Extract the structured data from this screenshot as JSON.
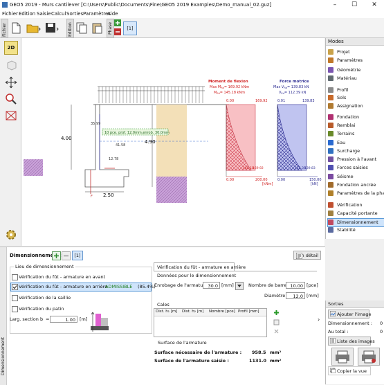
{
  "window": {
    "title": "GEO5 2019 - Murs cantilever [C:\\Users\\Public\\Documents\\Fine\\GEO5 2019 Examples\\Demo_manual_02.guz]",
    "minimize": "–",
    "maximize": "☐",
    "close": "✕"
  },
  "menu": [
    "Fichier",
    "Edition",
    "Saisie",
    "Calcul",
    "Sorties",
    "Paramètres",
    "Aide"
  ],
  "toolbar": {
    "tab_fichier": "Fichier",
    "tab_edition": "Edition",
    "tab_phase": "Phase",
    "phase_number": "[1]"
  },
  "lefttools": {
    "view_2d": "2D"
  },
  "drawing": {
    "dim_height": "4.00",
    "dim_height2": "4.90",
    "dim_width": "2.50",
    "dim_a": "35.99",
    "dim_b": "41.58",
    "dim_c": "12.78",
    "reinf_label": "10 pce. prof. 12.0mm,enrob. 30.0mm",
    "load_label": "F",
    "moment_title": "Moment de flexion",
    "moment_max1": "Max M",
    "moment_max1_sub": "Rd",
    "moment_max1_val": "= 169.92 kNm",
    "moment_max2": "M",
    "moment_max2_sub": "Ed",
    "moment_max2_val": "= 145.18 kNm",
    "moment_top_left": "0.00",
    "moment_top_right": "169.92",
    "moment_bot_mid": "145.10",
    "moment_bot_right": "169.92",
    "moment_axis_left": "0.00",
    "moment_axis_right": "200.00",
    "moment_unit": "[kNm]",
    "force_title": "Force motrice",
    "force_max1": "Max V",
    "force_max1_sub": "Rd",
    "force_max1_val": "= 139.83 kN",
    "force_max2": "V",
    "force_max2_sub": "Ed",
    "force_max2_val": "= 112.39 kN",
    "force_top_left": "0.01",
    "force_top_right": "139.83",
    "force_bot_mid": "112.39",
    "force_bot_right": "139.83",
    "force_axis_left": "0.00",
    "force_axis_right": "150.00",
    "force_unit": "[kN]"
  },
  "modes": {
    "header": "Modes",
    "items": [
      {
        "label": "Projet",
        "color": "#c9a24a"
      },
      {
        "label": "Paramètres",
        "color": "#c0782a"
      },
      {
        "label": "Géométrie",
        "color": "#7a55b0"
      },
      {
        "label": "Matériau",
        "color": "#606a70"
      },
      {
        "label": "Profil",
        "color": "#8a8a8a"
      },
      {
        "label": "Sols",
        "color": "#c86a2a"
      },
      {
        "label": "Assignation",
        "color": "#b07a30"
      },
      {
        "label": "Fondation",
        "color": "#b03070"
      },
      {
        "label": "Remblai",
        "color": "#b85b2a"
      },
      {
        "label": "Terrains",
        "color": "#6a8a2a"
      },
      {
        "label": "Eau",
        "color": "#2a6ad0"
      },
      {
        "label": "Surcharge",
        "color": "#3070c0"
      },
      {
        "label": "Pression à l'avant",
        "color": "#7050a0"
      },
      {
        "label": "Forces saisies",
        "color": "#5050b0"
      },
      {
        "label": "Séisme",
        "color": "#7a4aa0"
      },
      {
        "label": "Fondation ancrée",
        "color": "#a06a2a"
      },
      {
        "label": "Paramètres de la phase",
        "color": "#b0802a"
      },
      {
        "label": "Vérification",
        "color": "#c05030"
      },
      {
        "label": "Capacité portante",
        "color": "#a08040"
      },
      {
        "label": "Dimensionnement",
        "color": "#c04a60"
      },
      {
        "label": "Stabilité",
        "color": "#5a6aa0"
      }
    ]
  },
  "bottom": {
    "title": "Dimensionnement :",
    "phase": "[1]",
    "detail_button": "En détail",
    "lieu_group": "Lieu de dimensionnement",
    "options": [
      {
        "label": "Vérification du fût - armature en avant",
        "checked": false
      },
      {
        "label": "Vérification du fût - armature en arrière",
        "checked": true
      },
      {
        "label": "Vérification de la saillie",
        "checked": false
      },
      {
        "label": "Vérification du patin",
        "checked": false
      }
    ],
    "admissible": "ADMISSIBLE",
    "percent": "(85.4%)",
    "larg_label": "Larg. section :",
    "b_label": "b",
    "eq": "=",
    "b_value": "1.00",
    "b_unit": "[m]",
    "side_label": "Dimensionnement",
    "tab": "Vérification du fût - armature en arrière",
    "donnees_group": "Données pour le dimensionnement",
    "enrobage_label": "Enrobage de l'armature :",
    "enrobage_value": "30.0",
    "enrobage_unit": "[mm]",
    "nombre_label": "Nombre de barres :",
    "nombre_value": "10.00",
    "nombre_unit": "[pce]",
    "diametre_label": "Diamètre :",
    "diametre_value": "12.0",
    "diametre_unit": "[mm]",
    "cales_group": "Cales",
    "cales_headers": [
      "Dist. h₁ [m]",
      "Dist. h₂ [m]",
      "Nombre [pce]",
      "Profil [mm]"
    ],
    "surface_group": "Surface de l'armature",
    "surface_req_label": "Surface nécessaire de l'armature :",
    "surface_req_value": "958.5",
    "surface_req_unit": "mm²",
    "surface_sai_label": "Surface de l'armature saisie :",
    "surface_sai_value": "1131.0",
    "surface_sai_unit": "mm²"
  },
  "outputs": {
    "header": "Sorties",
    "add_image": "Ajouter l'image",
    "dim_label": "Dimensionnement :",
    "dim_count": "0",
    "total_label": "Au total :",
    "total_count": "0",
    "list_images": "Liste des images",
    "copy_view": "Copier la vue"
  }
}
